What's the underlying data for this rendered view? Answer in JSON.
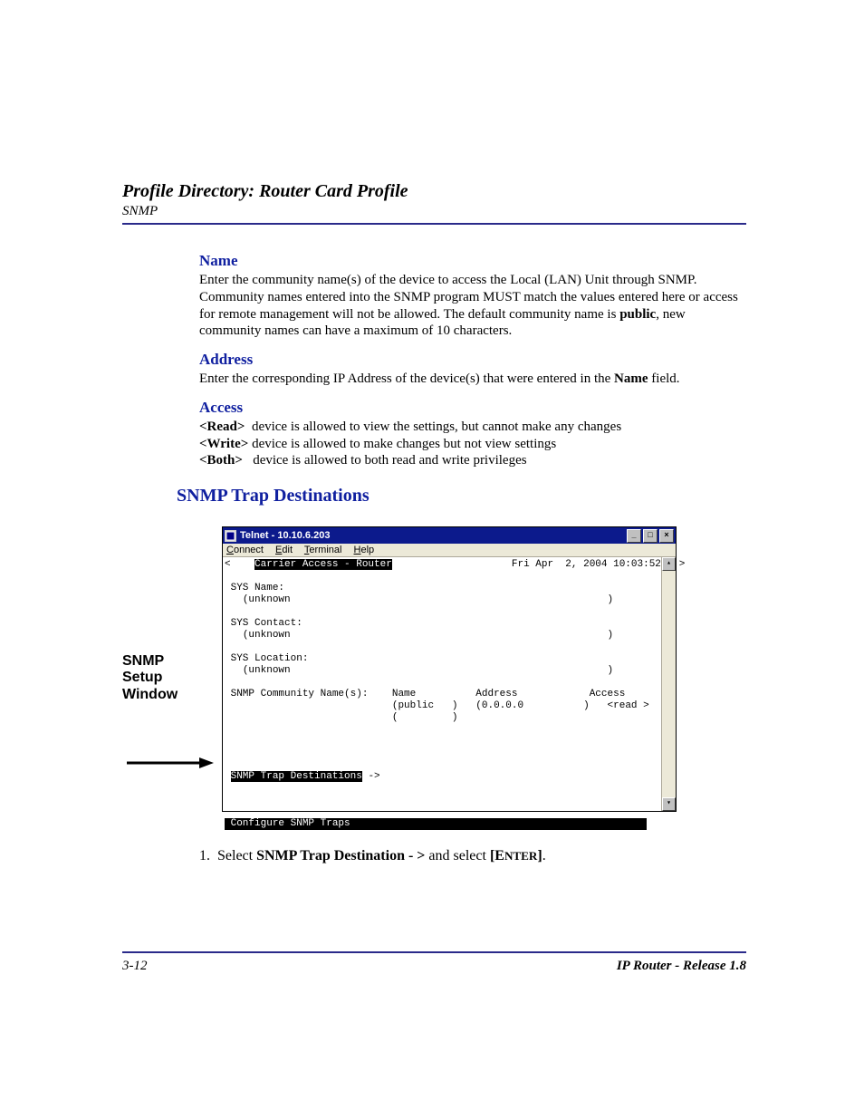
{
  "header": {
    "title": "Profile Directory: Router Card Profile",
    "subtitle": "SNMP"
  },
  "sections": {
    "name": {
      "heading": "Name",
      "text_pre": "Enter the community name(s) of the device to access the Local (LAN) Unit through SNMP. Community names entered into the SNMP program MUST match the values entered here or access for remote management will not be allowed. The default community name is ",
      "bold": "public",
      "text_post": ", new community names can have a maximum of 10 characters."
    },
    "address": {
      "heading": "Address",
      "text_pre": "Enter the corresponding IP Address of the device(s) that were entered in the ",
      "bold": "Name",
      "text_post": " field."
    },
    "access": {
      "heading": "Access",
      "rows": [
        {
          "tag": "<Read>",
          "desc": "  device is allowed to view the settings, but cannot make any changes"
        },
        {
          "tag": "<Write>",
          "desc": " device is allowed to make changes but not view settings"
        },
        {
          "tag": "<Both>",
          "desc": "   device is allowed to both read and write privileges"
        }
      ]
    },
    "trap_heading": "SNMP Trap Destinations"
  },
  "side_label": "SNMP Setup Window",
  "telnet": {
    "title": "Telnet - 10.10.6.203",
    "menu": [
      "Connect",
      "Edit",
      "Terminal",
      "Help"
    ],
    "top_left_mark": "<",
    "top_banner": "Carrier Access - Router",
    "timestamp": "Fri Apr  2, 2004 10:03:52",
    "top_right_mark": ">",
    "fields": {
      "sys_name_label": "SYS Name:",
      "sys_name_value": "(unknown",
      "sys_contact_label": "SYS Contact:",
      "sys_contact_value": "(unknown",
      "sys_location_label": "SYS Location:",
      "sys_location_value": "(unknown",
      "close_paren": ")",
      "community_label": "SNMP Community Name(s):",
      "col_name": "Name",
      "col_address": "Address",
      "col_access": "Access",
      "row1_name": "(public   )",
      "row1_addr": "(0.0.0.0          )",
      "row1_access": "<read >",
      "row2_name": "(         )"
    },
    "trap_line": "SNMP Trap Destinations",
    "trap_arrow": " ->",
    "status_bar": "Configure SNMP Traps"
  },
  "step": {
    "num": "1.",
    "pre": "Select ",
    "b1": "SNMP Trap Destination - > ",
    "mid": "and select ",
    "b2_open": "[E",
    "b2_sc": "NTER",
    "b2_close": "]",
    "post": "."
  },
  "footer": {
    "page": "3-12",
    "right": "IP Router - Release 1.8"
  }
}
